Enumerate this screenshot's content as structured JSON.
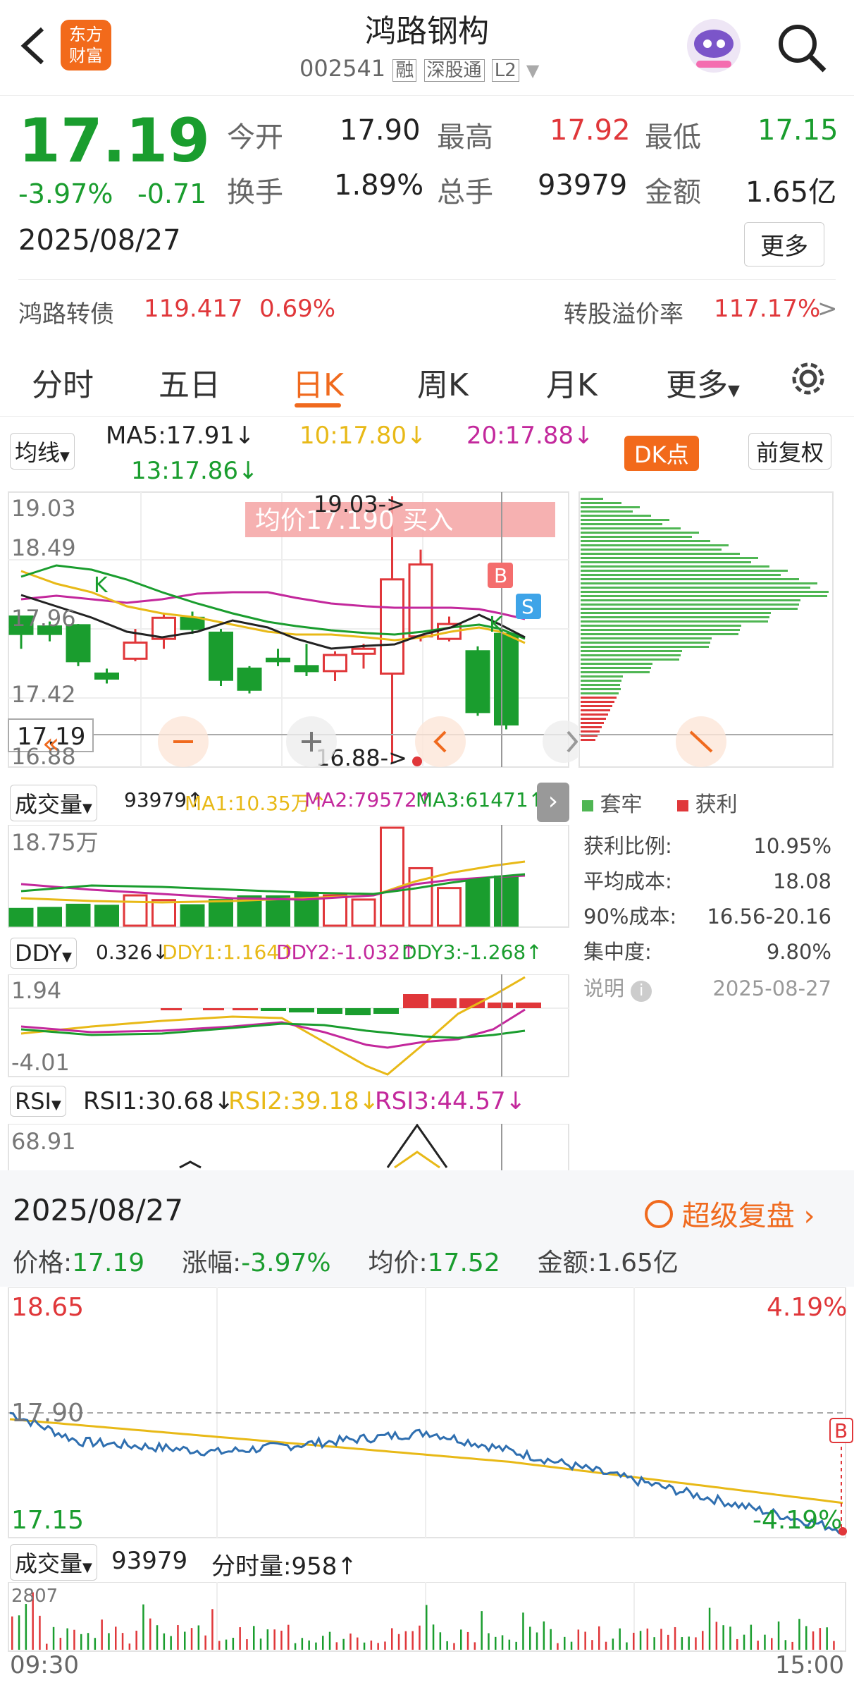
{
  "header": {
    "title": "鸿路钢构",
    "code": "002541",
    "badges": [
      "融",
      "深股通",
      "L2"
    ],
    "logo_text": "东方财富"
  },
  "quote": {
    "price": "17.19",
    "change_pct": "-3.97%",
    "change_abs": "-0.71",
    "date": "2025/08/27",
    "open_label": "今开",
    "open": "17.90",
    "high_label": "最高",
    "high": "17.92",
    "low_label": "最低",
    "low": "17.15",
    "turnover_label": "换手",
    "turnover": "1.89%",
    "volume_label": "总手",
    "volume": "93979",
    "amount_label": "金额",
    "amount": "1.65亿",
    "more_label": "更多"
  },
  "bond": {
    "name": "鸿路转债",
    "price": "119.417",
    "pct": "0.69%",
    "premium_label": "转股溢价率",
    "premium": "117.17%",
    "arrow": ">"
  },
  "tabs": {
    "fenshi": "分时",
    "wuri": "五日",
    "rik": "日K",
    "zhouk": "周K",
    "yuek": "月K",
    "more": "更多",
    "active": "日K"
  },
  "kchart": {
    "ma_button": "均线",
    "ma5": "MA5:17.91↓",
    "ma10": "10:17.80↓",
    "ma20": "20:17.88↓",
    "ma13": "13:17.86↓",
    "dk_button": "DK点",
    "fq_button": "前复权",
    "price_top": "19.03",
    "price_2": "18.49",
    "price_3": "17.96",
    "price_4": "17.42",
    "price_bottom": "16.88",
    "avg_banner": "均价17.190 买入",
    "high_mark": "19.03->",
    "low_mark": "16.88->",
    "cursor_price": "17.19",
    "mark_b": "B",
    "mark_s": "S",
    "mark_k": "K",
    "candles": [
      {
        "o": 18.06,
        "c": 17.92,
        "h": 18.06,
        "l": 17.8
      },
      {
        "o": 17.98,
        "c": 17.92,
        "h": 18.02,
        "l": 17.86
      },
      {
        "o": 17.99,
        "c": 17.7,
        "h": 18.0,
        "l": 17.66
      },
      {
        "o": 17.6,
        "c": 17.56,
        "h": 17.64,
        "l": 17.52
      },
      {
        "o": 17.72,
        "c": 17.85,
        "h": 17.96,
        "l": 17.7
      },
      {
        "o": 17.88,
        "c": 18.05,
        "h": 18.08,
        "l": 17.8
      },
      {
        "o": 18.05,
        "c": 17.96,
        "h": 18.1,
        "l": 17.92
      },
      {
        "o": 17.93,
        "c": 17.55,
        "h": 17.96,
        "l": 17.5
      },
      {
        "o": 17.64,
        "c": 17.47,
        "h": 17.66,
        "l": 17.44
      },
      {
        "o": 17.72,
        "c": 17.7,
        "h": 17.8,
        "l": 17.66
      },
      {
        "o": 17.66,
        "c": 17.62,
        "h": 17.84,
        "l": 17.58
      },
      {
        "o": 17.62,
        "c": 17.75,
        "h": 17.78,
        "l": 17.54
      },
      {
        "o": 17.76,
        "c": 17.8,
        "h": 17.84,
        "l": 17.64
      },
      {
        "o": 17.6,
        "c": 18.36,
        "h": 19.03,
        "l": 16.88
      },
      {
        "o": 17.9,
        "c": 18.48,
        "h": 18.6,
        "l": 17.86
      },
      {
        "o": 17.88,
        "c": 18.0,
        "h": 18.06,
        "l": 17.86
      },
      {
        "o": 17.78,
        "c": 17.29,
        "h": 17.82,
        "l": 17.26
      },
      {
        "o": 17.92,
        "c": 17.19,
        "h": 17.92,
        "l": 17.15
      }
    ]
  },
  "volume": {
    "label": "成交量",
    "value": "93979↑",
    "ma1": "MA1:10.35万↑",
    "ma2": "MA2:79572↑",
    "ma3": "MA3:61471↑",
    "top": "18.75万",
    "bars": [
      3.2,
      3.4,
      4.0,
      3.8,
      5.8,
      4.9,
      3.9,
      4.9,
      5.6,
      5.6,
      6.2,
      5.8,
      5.0,
      18.75,
      11.0,
      7.2,
      8.8,
      9.4
    ]
  },
  "ddy": {
    "label": "DDY",
    "value": "0.326↓",
    "ddy1": "DDY1:1.164↑",
    "ddy2": "DDY2:-1.032↑",
    "ddy3": "DDY3:-1.268↑",
    "top": "1.94",
    "bottom": "-4.01"
  },
  "rsi": {
    "label": "RSI",
    "rsi1": "RSI1:30.68↓",
    "rsi2": "RSI2:39.18↓",
    "rsi3": "RSI3:44.57↓",
    "top": "68.91"
  },
  "chips": {
    "legend_trap": "套牢",
    "legend_profit": "获利",
    "profit_ratio_label": "获利比例:",
    "profit_ratio": "10.95%",
    "avg_cost_label": "平均成本:",
    "avg_cost": "18.08",
    "cost90_label": "90%成本:",
    "cost90": "16.56-20.16",
    "concentration_label": "集中度:",
    "concentration": "9.80%",
    "note_label": "说明",
    "note_date": "2025-08-27"
  },
  "intraday": {
    "date": "2025/08/27",
    "replay": "超级复盘",
    "price_label": "价格:",
    "price": "17.19",
    "change_label": "涨幅:",
    "change": "-3.97%",
    "avg_label": "均价:",
    "avg": "17.52",
    "amount_label": "金额:",
    "amount": "1.65亿",
    "top_price": "18.65",
    "top_pct": "4.19%",
    "mid_price": "17.90",
    "bottom_price": "17.15",
    "bottom_pct": "-4.19%",
    "vol_label": "成交量",
    "vol_value": "93979",
    "fenshi_vol": "分时量:958↑",
    "vol_top": "2807",
    "time_start": "09:30",
    "time_end": "15:00",
    "mark_b": "B"
  },
  "colors": {
    "up": "#e0373a",
    "down": "#1a9d2e",
    "accent": "#f06a1e",
    "ma5": "#222222",
    "ma10": "#e8b917",
    "ma20": "#c3289c",
    "ma13": "#1a9d2e"
  }
}
